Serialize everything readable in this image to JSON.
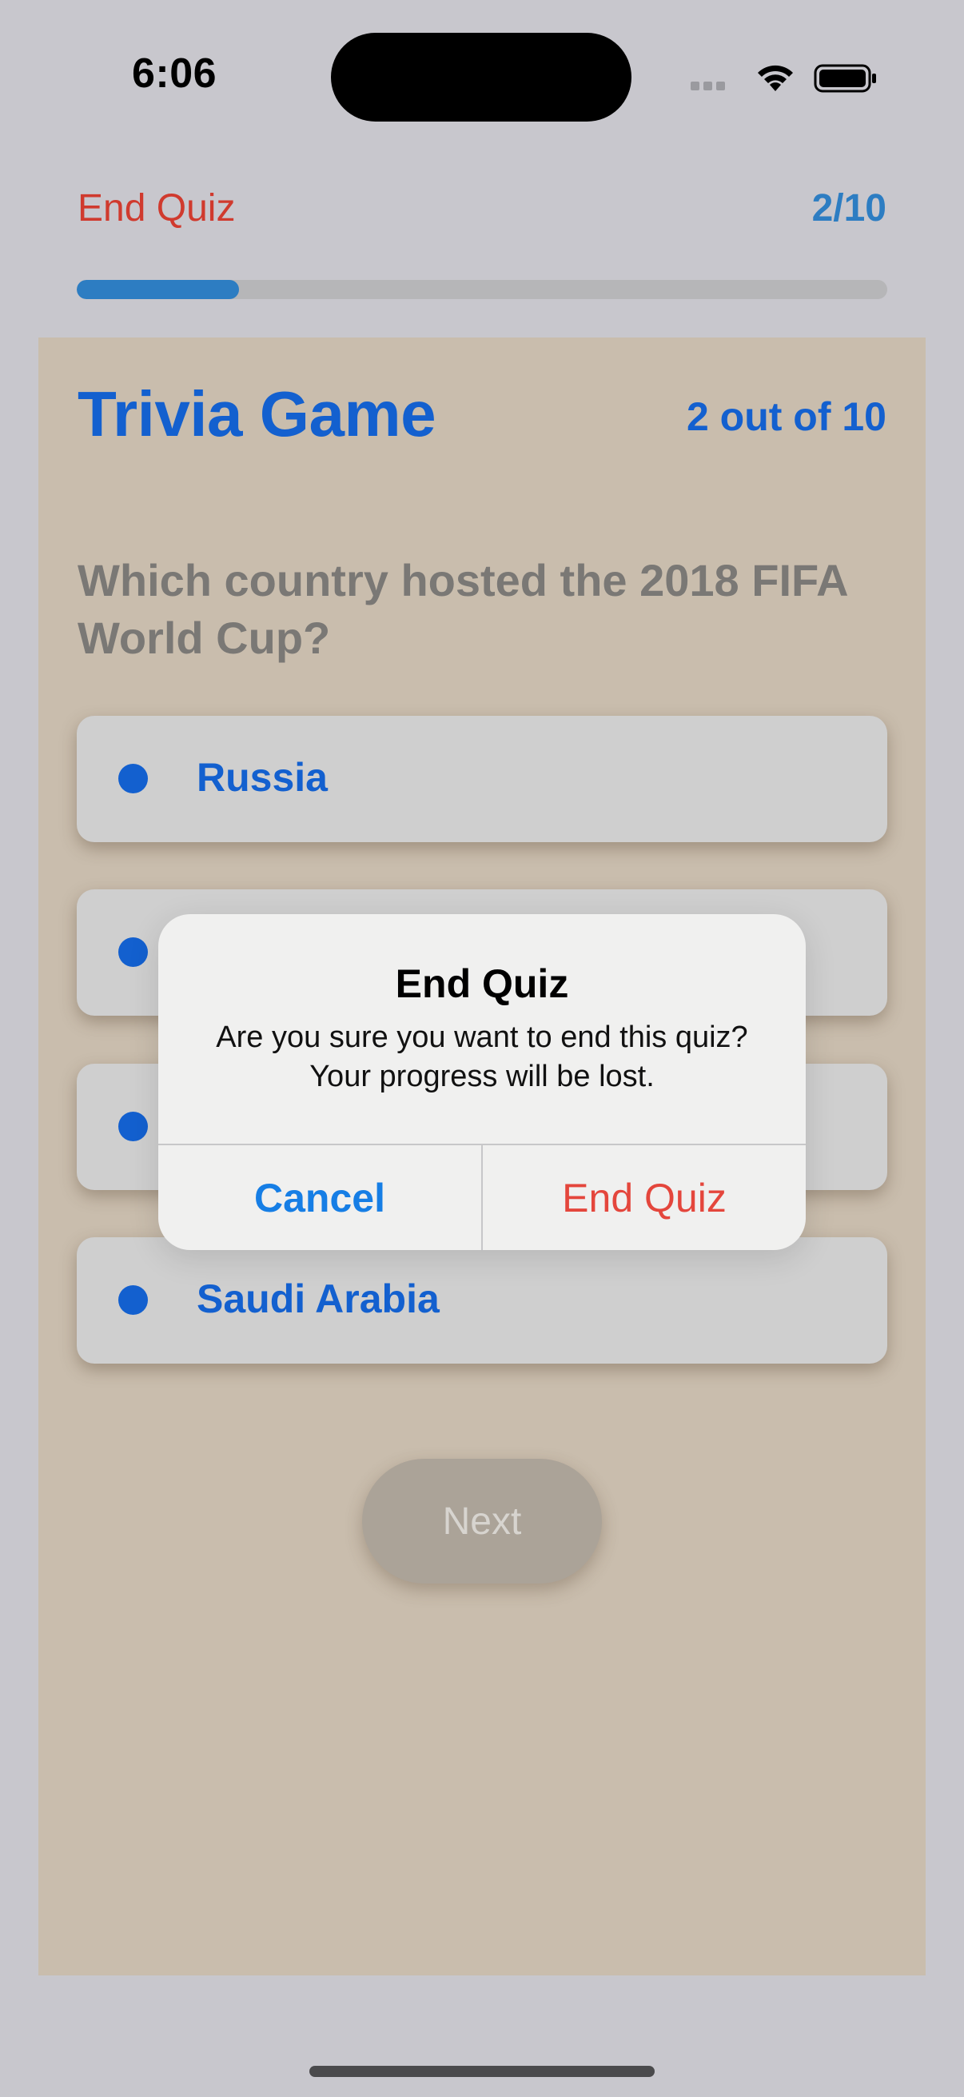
{
  "status_bar": {
    "time": "6:06",
    "icons": [
      "cellular-signal-icon",
      "wifi-icon",
      "battery-icon"
    ]
  },
  "nav": {
    "end_quiz_label": "End Quiz",
    "counter": "2/10",
    "progress_fraction": 0.2
  },
  "quiz": {
    "title": "Trivia Game",
    "subcount": "2 out of 10",
    "question": "Which country hosted the 2018 FIFA World Cup?",
    "options": [
      {
        "label": "Russia"
      },
      {
        "label": ""
      },
      {
        "label": ""
      },
      {
        "label": "Saudi Arabia"
      }
    ],
    "next_label": "Next"
  },
  "alert": {
    "title": "End Quiz",
    "message_line1": "Are you sure you want to end this quiz?",
    "message_line2": "Your progress will be lost.",
    "cancel_label": "Cancel",
    "confirm_label": "End Quiz"
  },
  "colors": {
    "accent_blue": "#1360cf",
    "destructive_red": "#e4463c",
    "panel_bg": "#c9bdad",
    "screen_bg": "#c8c7cd"
  }
}
